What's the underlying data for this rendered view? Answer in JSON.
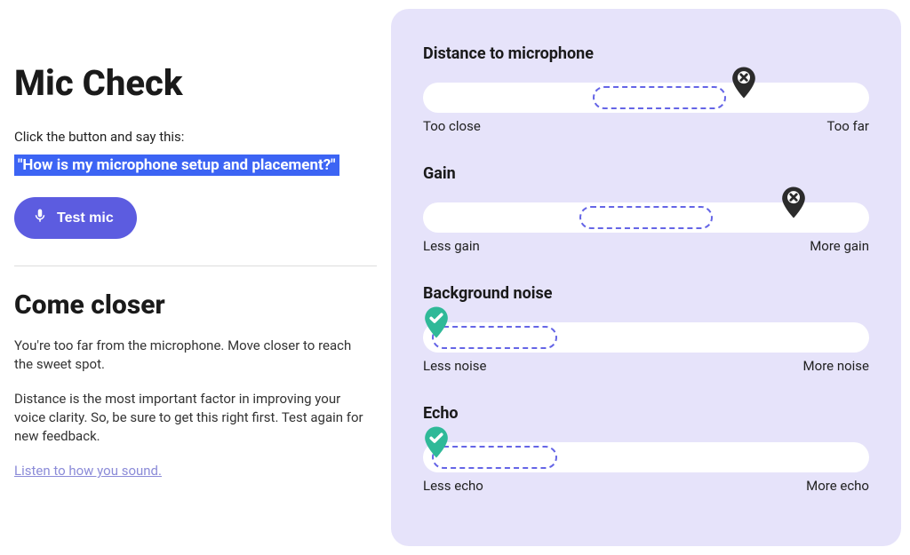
{
  "left": {
    "title": "Mic Check",
    "instruction": "Click the button and say this:",
    "prompt": "\"How is my microphone setup and placement?\"",
    "test_button": "Test mic",
    "feedback_title": "Come closer",
    "feedback_p1": "You're too far from the microphone. Move closer to reach the sweet spot.",
    "feedback_p2": "Distance is the most important factor in improving your voice clarity. So, be sure to get this right first. Test again for new feedback.",
    "listen_link": "Listen to how you sound."
  },
  "metrics": [
    {
      "title": "Distance to microphone",
      "low": "Too close",
      "high": "Too far",
      "sweet_left_pct": 38,
      "sweet_width_pct": 30,
      "marker_pct": 72,
      "status": "bad"
    },
    {
      "title": "Gain",
      "low": "Less gain",
      "high": "More gain",
      "sweet_left_pct": 35,
      "sweet_width_pct": 30,
      "marker_pct": 83,
      "status": "bad"
    },
    {
      "title": "Background noise",
      "low": "Less noise",
      "high": "More noise",
      "sweet_left_pct": 2,
      "sweet_width_pct": 28,
      "marker_pct": 3,
      "status": "good"
    },
    {
      "title": "Echo",
      "low": "Less echo",
      "high": "More echo",
      "sweet_left_pct": 2,
      "sweet_width_pct": 28,
      "marker_pct": 3,
      "status": "good"
    }
  ],
  "icons": {
    "mic": "mic-icon",
    "good": "check-pin-icon",
    "bad": "x-pin-icon"
  },
  "colors": {
    "accent": "#5c5ce0",
    "panel": "#e6e3fa",
    "good": "#2fb998",
    "bad": "#2b2b2b",
    "highlight": "#3c64f4"
  }
}
